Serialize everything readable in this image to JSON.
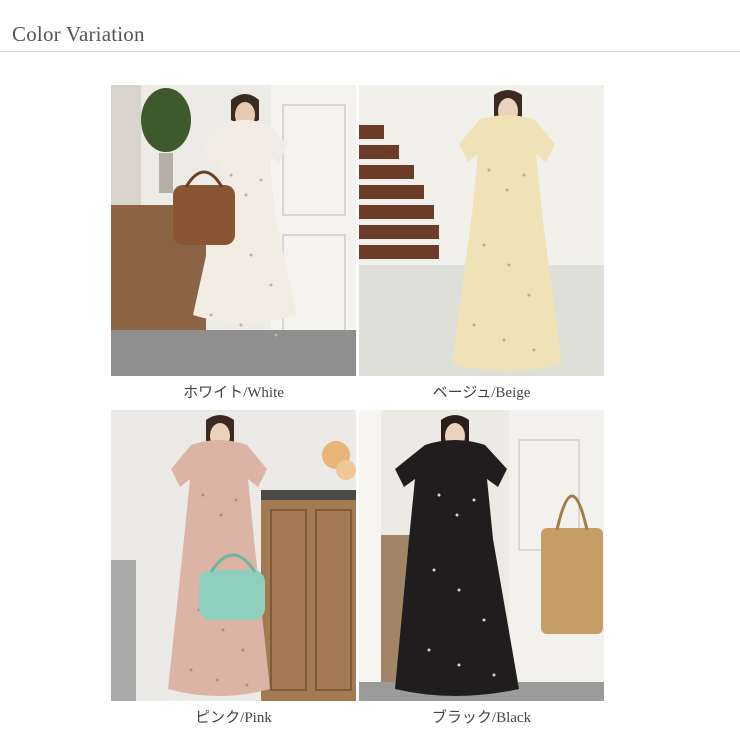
{
  "page": {
    "title": "Color Variation"
  },
  "variants": [
    {
      "label": "ホワイト/White",
      "dress_color": "#f1ede4",
      "dot_color": "#b9b3a6",
      "wall_color": "#ecebe6",
      "floor_color": "#8b6446",
      "accent": "bag-brown",
      "accent_color": "#8a5532"
    },
    {
      "label": "ベージュ/Beige",
      "dress_color": "#efe2b7",
      "dot_color": "#c2ad73",
      "wall_color": "#f1f0ea",
      "floor_color": "#dfdfd9",
      "accent": "stairs",
      "accent_color": "#6b3d28"
    },
    {
      "label": "ピンク/Pink",
      "dress_color": "#dcb4a6",
      "dot_color": "#b88a7a",
      "wall_color": "#eceae6",
      "floor_color": "#a37a52",
      "accent": "bag-mint",
      "accent_color": "#8ed0bd"
    },
    {
      "label": "ブラック/Black",
      "dress_color": "#1f1d1d",
      "dot_color": "#d9d4cc",
      "wall_color": "#eceae4",
      "floor_color": "#a28466",
      "accent": "bag-straw",
      "accent_color": "#c79d66"
    }
  ]
}
